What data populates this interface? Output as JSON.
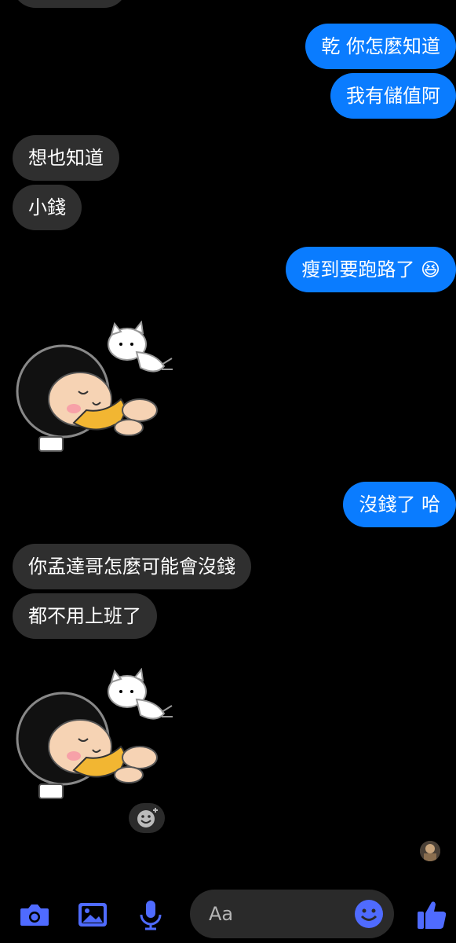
{
  "messages": [
    {
      "dir": "in",
      "text": ""
    },
    {
      "dir": "out",
      "text": "乾 你怎麼知道"
    },
    {
      "dir": "out",
      "text": "我有儲值阿"
    },
    {
      "dir": "in",
      "text": "想也知道"
    },
    {
      "dir": "in",
      "text": "小錢"
    },
    {
      "dir": "out",
      "text": "瘦到要跑路了",
      "emoji": "😆"
    },
    {
      "dir": "in",
      "type": "sticker",
      "sticker": "girl-lying-with-cat-sticker"
    },
    {
      "dir": "out",
      "text": "沒錢了 哈"
    },
    {
      "dir": "in",
      "text": "你孟達哥怎麼可能會沒錢"
    },
    {
      "dir": "in",
      "text": "都不用上班了"
    },
    {
      "dir": "in",
      "type": "sticker",
      "sticker": "girl-lying-with-cat-sticker"
    }
  ],
  "composer": {
    "placeholder": "Aa",
    "icons": [
      "camera-icon",
      "gallery-icon",
      "microphone-icon",
      "emoji-icon",
      "thumbs-up-icon"
    ]
  },
  "colors": {
    "accent": "#0a7cff",
    "incoming": "#2f2f2f",
    "background": "#000000",
    "icon": "#4f6bff"
  }
}
